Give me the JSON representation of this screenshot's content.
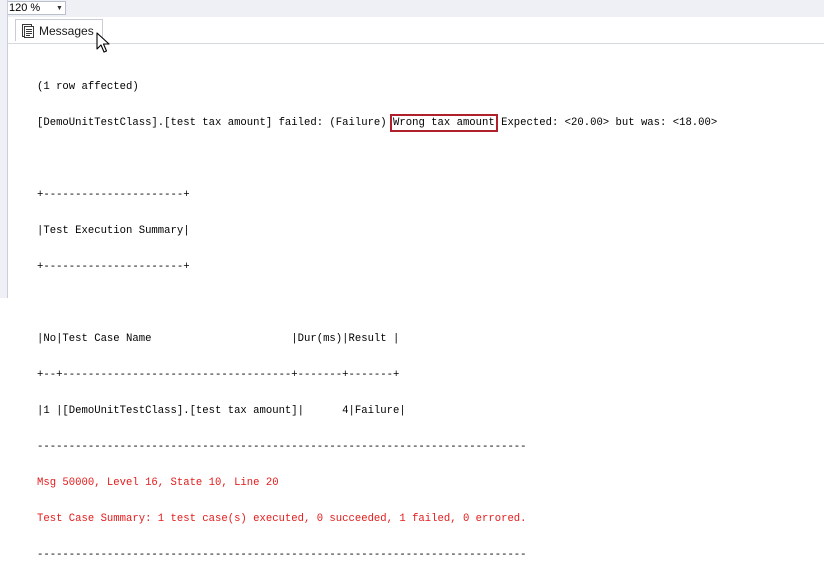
{
  "toolbar": {
    "zoom_value": "120 %"
  },
  "tabs": [
    {
      "label": "Messages",
      "icon": "messages-icon"
    }
  ],
  "output": {
    "rows_affected": "(1 row affected)",
    "failure_prefix": "[DemoUnitTestClass].[test tax amount] failed: (Failure)",
    "failure_highlight": "Wrong tax amount",
    "failure_suffix": "Expected: <20.00> but was: <18.00>",
    "summary_border_top": "+----------------------+",
    "summary_title": "|Test Execution Summary|",
    "summary_border_bottom": "+----------------------+",
    "table_header": "|No|Test Case Name                      |Dur(ms)|Result |",
    "table_separator": "+--+------------------------------------+-------+-------+",
    "table_row": "|1 |[DemoUnitTestClass].[test tax amount]|      4|Failure|",
    "rule_top": "-----------------------------------------------------------------------------",
    "error_message": "Msg 50000, Level 16, State 10, Line 20",
    "test_summary": "Test Case Summary: 1 test case(s) executed, 0 succeeded, 1 failed, 0 errored.",
    "rule_bottom": "-----------------------------------------------------------------------------"
  },
  "colors": {
    "error_text": "#e31b1b",
    "highlight_border": "#b0202a"
  }
}
